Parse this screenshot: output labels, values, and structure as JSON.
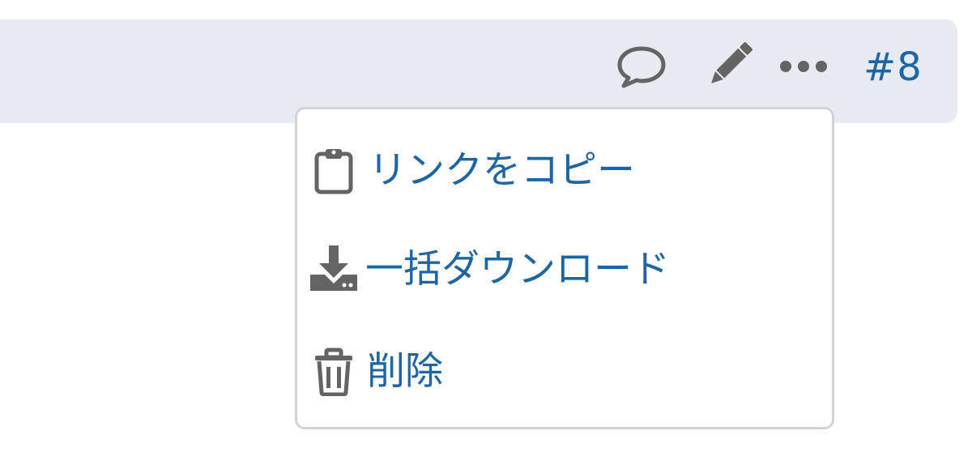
{
  "post_controls": {
    "reply_icon": "speech-bubble-icon",
    "edit_icon": "pencil-icon",
    "more_icon": "ellipsis-icon",
    "post_number": "#8"
  },
  "menu": {
    "items": [
      {
        "label": "リンクをコピー",
        "icon": "clipboard-icon"
      },
      {
        "label": "一括ダウンロード",
        "icon": "download-icon"
      },
      {
        "label": "削除",
        "icon": "trash-icon"
      }
    ]
  },
  "colors": {
    "bar_background": "#e8eaf2",
    "link_blue": "#1d65a3",
    "icon_gray": "#646464",
    "menu_border": "#d2d2d4"
  }
}
